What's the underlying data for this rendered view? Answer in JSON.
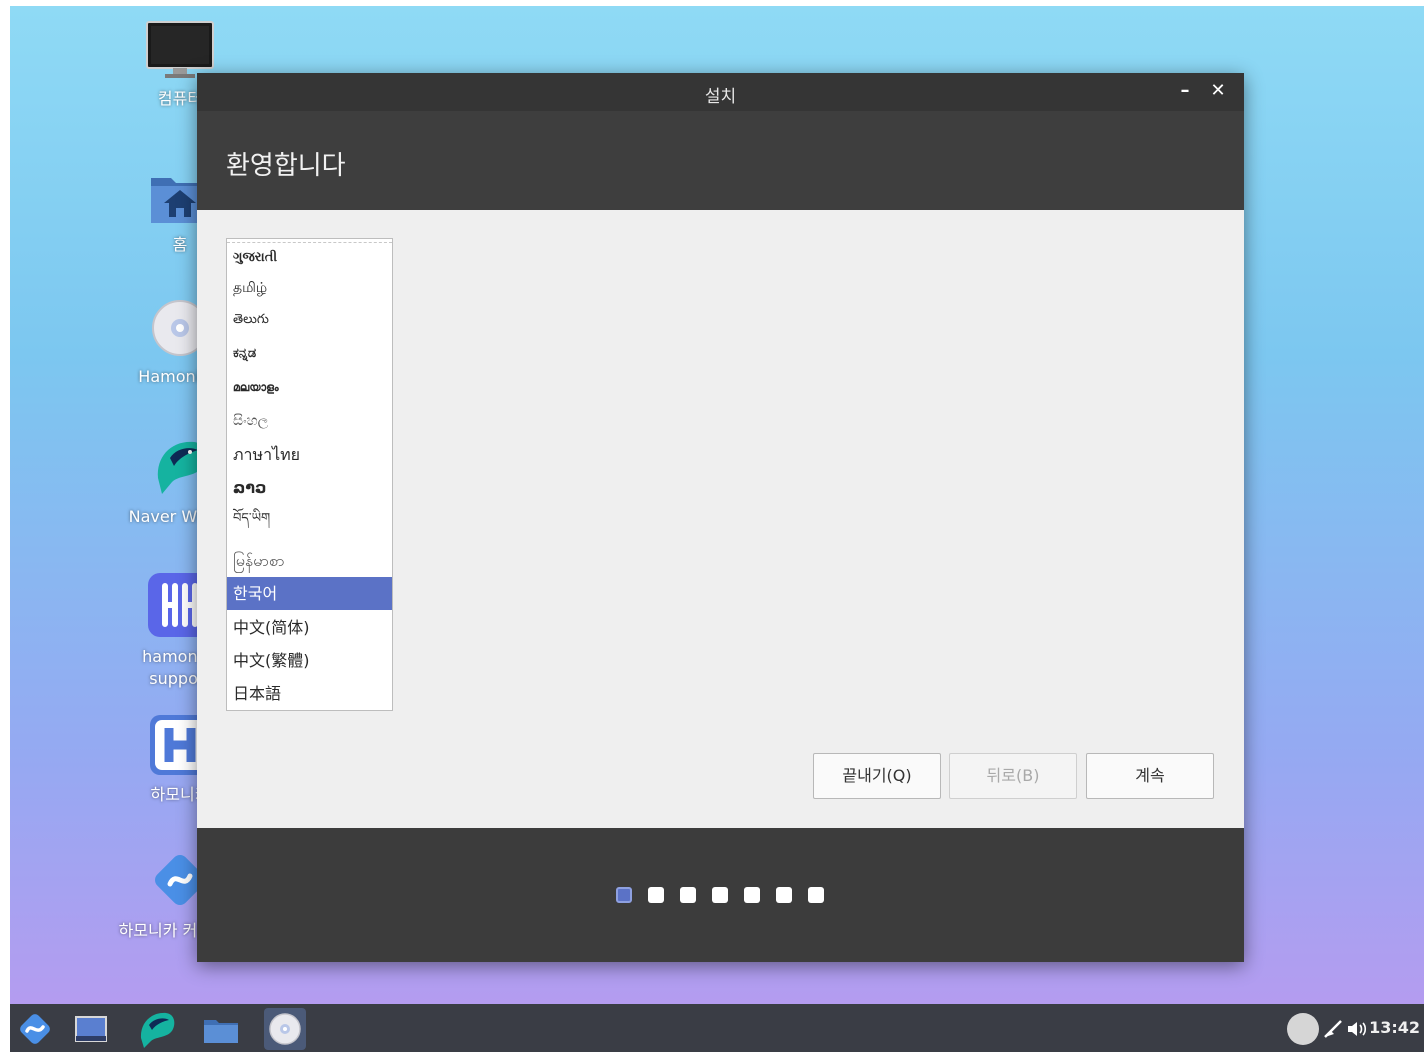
{
  "desktop": {
    "icons": [
      {
        "label": "컴퓨터"
      },
      {
        "label": "홈"
      },
      {
        "label": "HamoniKR"
      },
      {
        "label": "Naver Whale"
      },
      {
        "label": "hamonikr support"
      },
      {
        "label": "하모니카"
      },
      {
        "label": "하모니카 커뮤니티"
      }
    ]
  },
  "window": {
    "title": "설치",
    "minimize_symbol": "–",
    "close_symbol": "✕",
    "heading": "환영합니다"
  },
  "languages": [
    {
      "label": "ગુજરાતી",
      "selected": false
    },
    {
      "label": "தமிழ்",
      "selected": false
    },
    {
      "label": "తెలుగు",
      "selected": false
    },
    {
      "label": "ಕನ್ನಡ",
      "selected": false
    },
    {
      "label": "മലയാളം",
      "selected": false
    },
    {
      "label": "සිංහල",
      "selected": false
    },
    {
      "label": "ภาษาไทย",
      "selected": false
    },
    {
      "label": "ລາວ",
      "selected": false
    },
    {
      "label": "བོད་ཡིག",
      "selected": false
    },
    {
      "label": "မြန်မာစာ",
      "selected": false
    },
    {
      "label": "한국어",
      "selected": true
    },
    {
      "label": "中文(简体)",
      "selected": false
    },
    {
      "label": "中文(繁體)",
      "selected": false
    },
    {
      "label": "日本語",
      "selected": false
    }
  ],
  "buttons": {
    "quit": "끝내기(Q)",
    "back": "뒤로(B)",
    "continue": "계속"
  },
  "progress": {
    "total_steps": 7,
    "current_step": 1
  },
  "taskbar": {
    "items": [
      "hamonikr-menu-icon",
      "show-desktop-icon",
      "whale-browser-icon",
      "file-manager-icon",
      "installer-disc-icon"
    ],
    "clock": "13:42"
  },
  "colors": {
    "accent": "#5b72c6",
    "window_dark": "#3c3c3c",
    "content_bg": "#efefef"
  }
}
